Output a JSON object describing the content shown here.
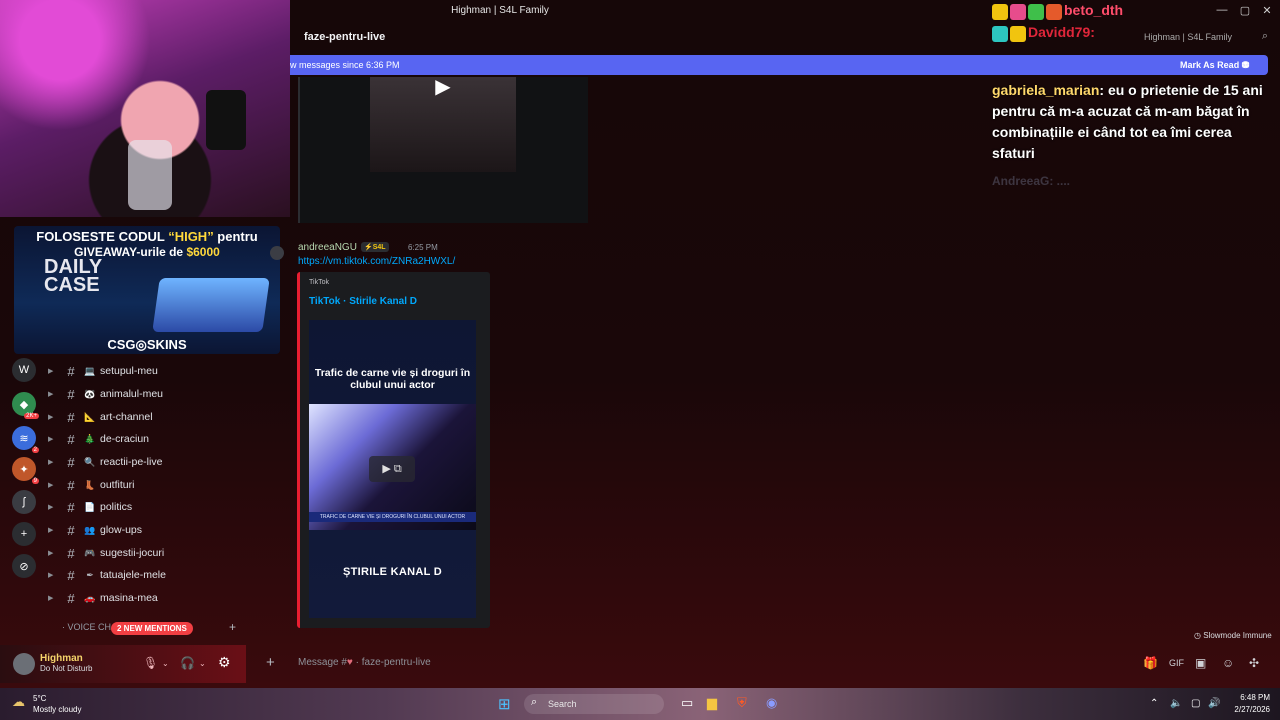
{
  "window": {
    "title": "Highman | S4L Family",
    "controls": [
      "—",
      "▢",
      "✕"
    ]
  },
  "header": {
    "channel": "faze-pentru-live",
    "search_label": "Highman | S4L Family"
  },
  "new_messages_banner": {
    "text": "w messages since 6:36 PM",
    "action": "Mark As Read"
  },
  "webcam": {
    "label": "streamer webcam"
  },
  "ad": {
    "line1_pre": "FOLOSESTE CODUL ",
    "line1_code": "“HIGH”",
    "line1_post": " pentru",
    "line2_pre": "GIVEAWAY-urile de ",
    "line2_amount": "$6000",
    "daily": "DAILY CASE",
    "brand": "CSG◎SKINS"
  },
  "servers": [
    {
      "icon": "W",
      "badge": ""
    },
    {
      "icon": "◆",
      "badge": "2K+"
    },
    {
      "icon": "≋",
      "badge": "2"
    },
    {
      "icon": "✦",
      "badge": "9"
    },
    {
      "icon": "ʃ",
      "badge": ""
    },
    {
      "icon": "+",
      "badge": ""
    },
    {
      "icon": "⊘",
      "badge": ""
    }
  ],
  "channels": [
    {
      "name": "setupul-meu",
      "emoji": "💻"
    },
    {
      "name": "animalul-meu",
      "emoji": "🐼"
    },
    {
      "name": "art-channel",
      "emoji": "📐"
    },
    {
      "name": "de-craciun",
      "emoji": "🎄"
    },
    {
      "name": "reactii-pe-live",
      "emoji": "🔍"
    },
    {
      "name": "outfituri",
      "emoji": "👢"
    },
    {
      "name": "politics",
      "emoji": "📄"
    },
    {
      "name": "glow-ups",
      "emoji": "👥"
    },
    {
      "name": "sugestii-jocuri",
      "emoji": "🎮"
    },
    {
      "name": "tatuajele-mele",
      "emoji": "✒"
    },
    {
      "name": "masina-mea",
      "emoji": "🚗"
    }
  ],
  "voice_category": "VOICE CH",
  "mentions_pill": "2 NEW MENTIONS",
  "user": {
    "name": "Highman",
    "status": "Do Not Disturb"
  },
  "messages": [
    {
      "author": "andreeaNGU",
      "tag": "⚡S4L",
      "time": "6:25 PM",
      "link": "https://vm.tiktok.com/ZNRa2HWXL/",
      "embed": {
        "provider": "TikTok",
        "title": "TikTok · Stirile Kanal D",
        "headline": "Trafic de carne vie și droguri în clubul unui actor",
        "ticker": "TRAFIC DE CARNE VIE ȘI DROGURI ÎN CLUBUL UNUI ACTOR",
        "logo": "ȘTIRILE KANAL D"
      }
    }
  ],
  "slowmode": "Slowmode Immune",
  "input": {
    "placeholder_prefix": "Message #",
    "placeholder_channel": "· faze-pentru-live"
  },
  "chat_overlay": {
    "top_user": "beto_dth",
    "user2": "Davidd79:",
    "main_user": "gabriela_marian",
    "main_text": ": eu o prietenie de 15 ani pentru că m-a acuzat că m-am băgat în combinațiile ei când tot ea îmi cerea sfaturi",
    "faded": "AndreeaG: ...."
  },
  "taskbar": {
    "temp": "5°C",
    "condition": "Mostly cloudy",
    "search": "Search",
    "time": "6:48 PM",
    "date": "2/27/2026"
  }
}
